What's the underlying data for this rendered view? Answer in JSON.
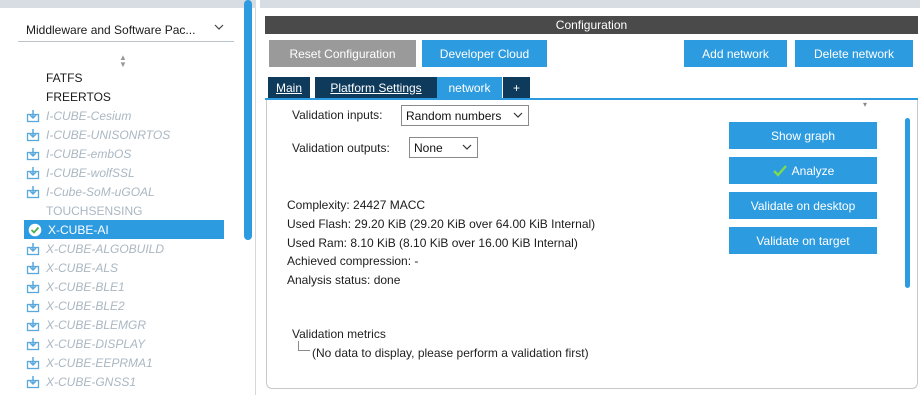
{
  "left": {
    "category_select": "Middleware and Software Pac...",
    "components": [
      {
        "label": "FATFS",
        "style": "plain",
        "icon": "none"
      },
      {
        "label": "FREERTOS",
        "style": "plain",
        "icon": "none"
      },
      {
        "label": "I-CUBE-Cesium",
        "style": "pack",
        "icon": "download-icon"
      },
      {
        "label": "I-CUBE-UNISONRTOS",
        "style": "pack",
        "icon": "download-icon"
      },
      {
        "label": "I-CUBE-embOS",
        "style": "pack",
        "icon": "download-icon"
      },
      {
        "label": "I-CUBE-wolfSSL",
        "style": "pack",
        "icon": "download-icon"
      },
      {
        "label": "I-Cube-SoM-uGOAL",
        "style": "pack",
        "icon": "download-icon"
      },
      {
        "label": "TOUCHSENSING",
        "style": "plain-disabled",
        "icon": "none"
      },
      {
        "label": "X-CUBE-AI",
        "style": "selected",
        "icon": "check-circle-icon"
      },
      {
        "label": "X-CUBE-ALGOBUILD",
        "style": "pack",
        "icon": "download-icon"
      },
      {
        "label": "X-CUBE-ALS",
        "style": "pack",
        "icon": "download-icon"
      },
      {
        "label": "X-CUBE-BLE1",
        "style": "pack",
        "icon": "download-icon"
      },
      {
        "label": "X-CUBE-BLE2",
        "style": "pack",
        "icon": "download-icon"
      },
      {
        "label": "X-CUBE-BLEMGR",
        "style": "pack",
        "icon": "download-icon"
      },
      {
        "label": "X-CUBE-DISPLAY",
        "style": "pack",
        "icon": "download-icon"
      },
      {
        "label": "X-CUBE-EEPRMA1",
        "style": "pack",
        "icon": "download-icon"
      },
      {
        "label": "X-CUBE-GNSS1",
        "style": "pack",
        "icon": "download-icon"
      }
    ]
  },
  "config": {
    "header": "Configuration",
    "reset_button": "Reset Configuration",
    "developer_cloud_button": "Developer Cloud",
    "add_network_button": "Add network",
    "delete_network_button": "Delete network",
    "tabs": [
      "Main",
      "Platform Settings",
      "network",
      "+"
    ],
    "validation_inputs_label": "Validation inputs:",
    "validation_inputs_value": "Random numbers",
    "validation_outputs_label": "Validation outputs:",
    "validation_outputs_value": "None",
    "complexity": "Complexity:  24427 MACC",
    "used_flash": "Used Flash: 29.20 KiB (29.20 KiB over 64.00 KiB Internal)",
    "used_ram": "Used Ram: 8.10 KiB (8.10 KiB over 16.00 KiB Internal)",
    "achieved_compression": "Achieved compression: -",
    "analysis_status": "Analysis status: done",
    "show_graph_button": "Show graph",
    "analyze_button": "Analyze",
    "validate_desktop_button": "Validate on desktop",
    "validate_target_button": "Validate on target",
    "metrics_title": "Validation metrics",
    "metrics_empty": "(No data to display, please perform a validation first)"
  },
  "colors": {
    "accent": "#2d9be0",
    "tab_dark": "#0e3a5c",
    "header_dark": "#4a4a4a",
    "disabled_text": "#aab7c2",
    "check_green": "#4caf50"
  }
}
